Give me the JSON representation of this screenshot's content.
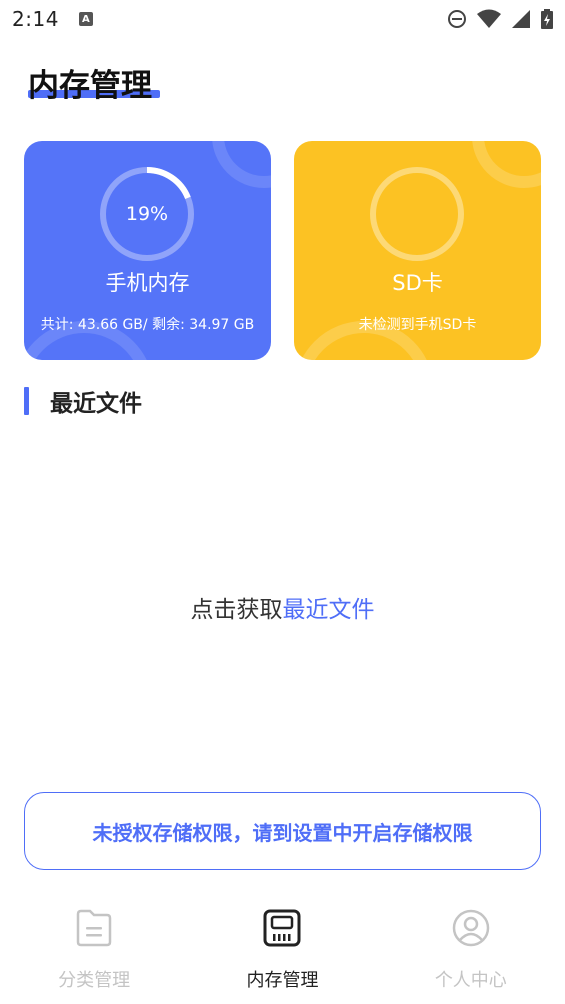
{
  "status": {
    "time": "2:14",
    "notif_icon": "a-icon",
    "dnd_icon": "dnd-icon",
    "wifi_icon": "wifi-icon",
    "signal_icon": "signal-icon",
    "battery_icon": "battery-charging-icon"
  },
  "page": {
    "title": "内存管理"
  },
  "phone_card": {
    "percent_label": "19%",
    "percent": 19,
    "label": "手机内存",
    "detail": "共计: 43.66 GB/ 剩余: 34.97 GB",
    "color": "#5574f8"
  },
  "sd_card": {
    "label": "SD卡",
    "detail": "未检测到手机SD卡",
    "color": "#fcc223"
  },
  "recent": {
    "section_title": "最近文件",
    "prompt_prefix": "点击获取",
    "prompt_link": "最近文件"
  },
  "permission": {
    "message": "未授权存储权限，请到设置中开启存储权限"
  },
  "tabs": [
    {
      "label": "分类管理",
      "icon": "file-category-icon",
      "active": false
    },
    {
      "label": "内存管理",
      "icon": "memory-card-icon",
      "active": true
    },
    {
      "label": "个人中心",
      "icon": "user-profile-icon",
      "active": false
    }
  ],
  "colors": {
    "accent": "#4f6ef7",
    "inactive": "#c4c4c4"
  }
}
